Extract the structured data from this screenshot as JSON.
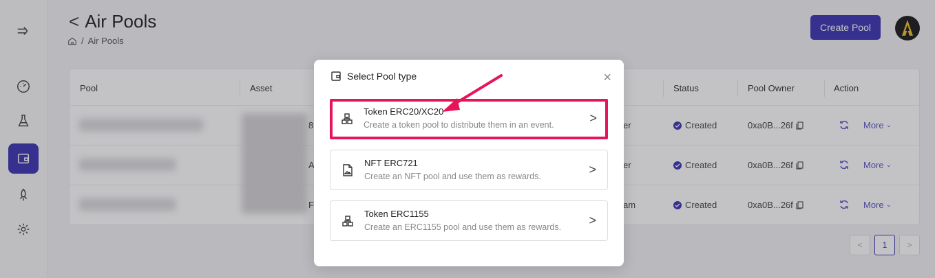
{
  "header": {
    "title": "Air Pools",
    "back_chevron": "<",
    "breadcrumb_separator": "/",
    "breadcrumb_current": "Air Pools",
    "create_button": "Create Pool"
  },
  "sidebar": {
    "items": [
      {
        "icon": "collapse-arrow-icon"
      },
      {
        "icon": "dashboard-gauge-icon"
      },
      {
        "icon": "flask-icon"
      },
      {
        "icon": "wallet-icon",
        "active": true
      },
      {
        "icon": "rocket-icon"
      },
      {
        "icon": "gear-icon"
      }
    ]
  },
  "table": {
    "columns": [
      "Pool",
      "Asset",
      "Status",
      "Pool Owner",
      "Action"
    ],
    "rows": [
      {
        "type_suffix": "er",
        "status": "Created",
        "owner": "0xa0B...26f",
        "more": "More"
      },
      {
        "type_suffix": "er",
        "status": "Created",
        "owner": "0xa0B...26f",
        "more": "More"
      },
      {
        "type_suffix": "am",
        "status": "Created",
        "owner": "0xa0B...26f",
        "more": "More"
      }
    ],
    "asset_fragments": [
      "8",
      "A",
      "F"
    ]
  },
  "pagination": {
    "prev": "<",
    "current": "1",
    "next": ">"
  },
  "modal": {
    "title": "Select Pool type",
    "close": "×",
    "options": [
      {
        "title": "Token ERC20/XC20",
        "desc": "Create a token pool to distribute them in an event.",
        "icon": "token-stack-icon",
        "highlighted": true
      },
      {
        "title": "NFT ERC721",
        "desc": "Create an NFT pool and use them as rewards.",
        "icon": "nft-image-icon"
      },
      {
        "title": "Token ERC1155",
        "desc": "Create an ERC1155 pool and use them as rewards.",
        "icon": "token-stack-icon"
      }
    ],
    "chevron": ">"
  },
  "colors": {
    "accent": "#3c35b5",
    "highlight": "#e8145a"
  }
}
